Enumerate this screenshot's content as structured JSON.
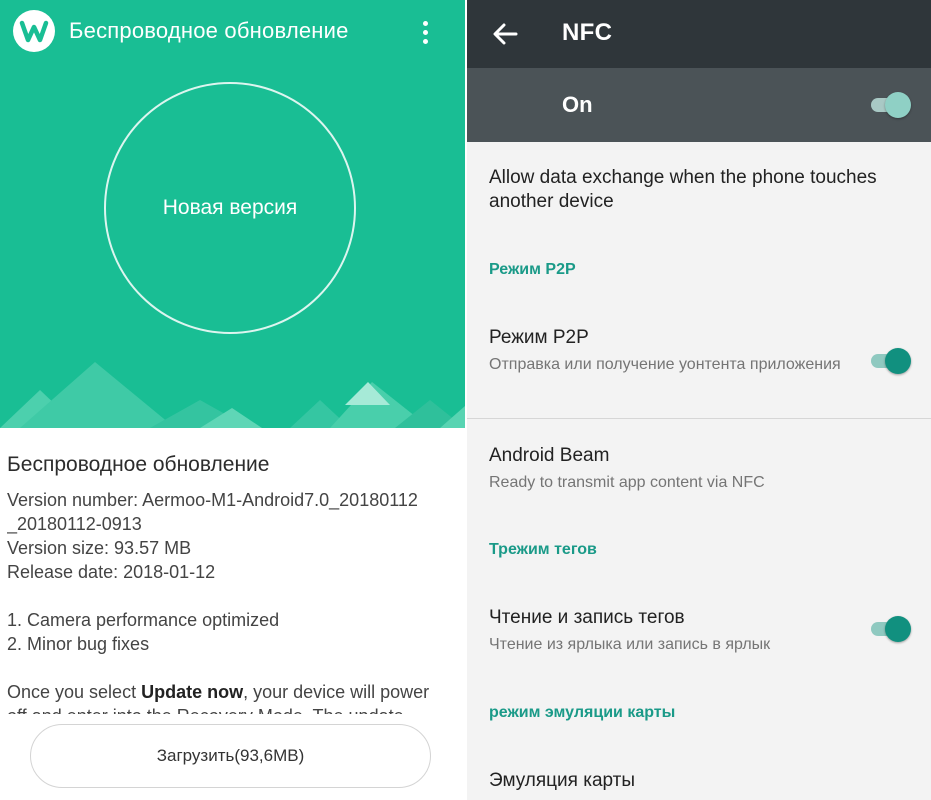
{
  "left": {
    "app_title": "Беспроводное обновление",
    "circle_label": "Новая версия",
    "info": {
      "heading": "Беспроводное обновление",
      "version_number": "Version number: Aermoo-M1-Android7.0_20180112",
      "version_number_cont": "_20180112-0913",
      "version_size": "Version size: 93.57 MB",
      "release_date": "Release date: 2018-01-12",
      "change_1": "1. Camera performance optimized",
      "change_2": "2. Minor bug fixes",
      "notice_prefix": "Once you select ",
      "notice_bold": "Update now",
      "notice_suffix": ", your device will power",
      "notice_cont": "off and enter into the Recovery Mode. The update"
    },
    "download_button": "Загрузить(93,6MB)",
    "colors": {
      "accent": "#19be94"
    }
  },
  "right": {
    "title": "NFC",
    "master_switch": {
      "label": "On",
      "state": true
    },
    "description": "Allow data exchange when the phone touches another device",
    "sections": [
      {
        "header": "Режим P2P",
        "items": [
          {
            "title": "Режим P2P",
            "subtitle": "Отправка или получение уонтента приложения",
            "toggle": true
          },
          {
            "title": "Android Beam",
            "subtitle": "Ready to transmit app content via NFC"
          }
        ]
      },
      {
        "header": "Трежим тегов",
        "items": [
          {
            "title": "Чтение и запись тегов",
            "subtitle": "Чтение из ярлыка или запись в ярлык",
            "toggle": true
          }
        ]
      },
      {
        "header": "режим эмуляции карты",
        "items": [
          {
            "title": "Эмуляция карты"
          }
        ]
      }
    ],
    "colors": {
      "header_bar": "#2f363a",
      "on_bar": "#4b5357",
      "accent": "#1a9a88"
    }
  },
  "icons": {
    "logo": "w-logo-icon",
    "more": "more-vert-icon",
    "back": "arrow-back-icon"
  }
}
